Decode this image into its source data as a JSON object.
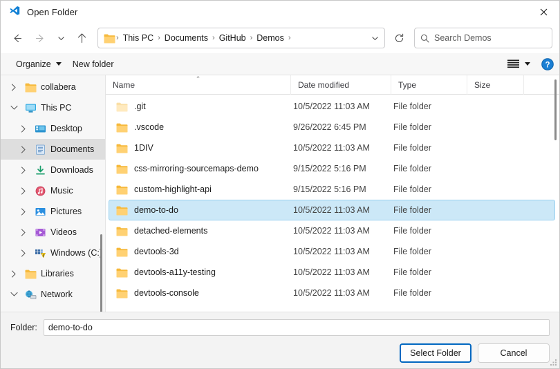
{
  "window": {
    "title": "Open Folder",
    "app_icon": "vscode-icon",
    "close_label": "✕"
  },
  "nav": {
    "back_label": "Back",
    "forward_label": "Forward",
    "recent_label": "Recent locations",
    "up_label": "Up",
    "refresh_label": "Refresh",
    "breadcrumb_dropdown_label": "Previous locations"
  },
  "breadcrumb": {
    "items": [
      "This PC",
      "Documents",
      "GitHub",
      "Demos"
    ],
    "separator": "›"
  },
  "search": {
    "placeholder": "Search Demos",
    "value": "",
    "icon": "search-icon"
  },
  "toolbar": {
    "organize_label": "Organize",
    "new_folder_label": "New folder",
    "view_icon": "list-view-icon",
    "help_icon": "help-icon"
  },
  "sidebar": {
    "items": [
      {
        "label": "collabera",
        "icon": "folder-icon",
        "indent": 1,
        "expanded": false,
        "selected": false
      },
      {
        "label": "This PC",
        "icon": "pc-icon",
        "indent": 1,
        "expanded": true,
        "selected": false
      },
      {
        "label": "Desktop",
        "icon": "desktop-icon",
        "indent": 2,
        "expanded": false,
        "selected": false
      },
      {
        "label": "Documents",
        "icon": "documents-icon",
        "indent": 2,
        "expanded": false,
        "selected": true
      },
      {
        "label": "Downloads",
        "icon": "downloads-icon",
        "indent": 2,
        "expanded": false,
        "selected": false
      },
      {
        "label": "Music",
        "icon": "music-icon",
        "indent": 2,
        "expanded": false,
        "selected": false
      },
      {
        "label": "Pictures",
        "icon": "pictures-icon",
        "indent": 2,
        "expanded": false,
        "selected": false
      },
      {
        "label": "Videos",
        "icon": "videos-icon",
        "indent": 2,
        "expanded": false,
        "selected": false
      },
      {
        "label": "Windows (C:)",
        "icon": "drive-icon",
        "indent": 2,
        "expanded": false,
        "selected": false
      },
      {
        "label": "Libraries",
        "icon": "folder-icon",
        "indent": 1,
        "expanded": false,
        "selected": false
      },
      {
        "label": "Network",
        "icon": "network-icon",
        "indent": 1,
        "expanded": true,
        "selected": false
      }
    ]
  },
  "filelist": {
    "columns": [
      {
        "label": "Name",
        "sorted": "asc"
      },
      {
        "label": "Date modified",
        "sorted": ""
      },
      {
        "label": "Type",
        "sorted": ""
      },
      {
        "label": "Size",
        "sorted": ""
      }
    ],
    "sort_caret": "⌃",
    "rows": [
      {
        "name": ".git",
        "date": "10/5/2022 11:03 AM",
        "type": "File folder",
        "size": "",
        "selected": false,
        "dim": true
      },
      {
        "name": ".vscode",
        "date": "9/26/2022 6:45 PM",
        "type": "File folder",
        "size": "",
        "selected": false,
        "dim": false
      },
      {
        "name": "1DIV",
        "date": "10/5/2022 11:03 AM",
        "type": "File folder",
        "size": "",
        "selected": false,
        "dim": false
      },
      {
        "name": "css-mirroring-sourcemaps-demo",
        "date": "9/15/2022 5:16 PM",
        "type": "File folder",
        "size": "",
        "selected": false,
        "dim": false
      },
      {
        "name": "custom-highlight-api",
        "date": "9/15/2022 5:16 PM",
        "type": "File folder",
        "size": "",
        "selected": false,
        "dim": false
      },
      {
        "name": "demo-to-do",
        "date": "10/5/2022 11:03 AM",
        "type": "File folder",
        "size": "",
        "selected": true,
        "dim": false
      },
      {
        "name": "detached-elements",
        "date": "10/5/2022 11:03 AM",
        "type": "File folder",
        "size": "",
        "selected": false,
        "dim": false
      },
      {
        "name": "devtools-3d",
        "date": "10/5/2022 11:03 AM",
        "type": "File folder",
        "size": "",
        "selected": false,
        "dim": false
      },
      {
        "name": "devtools-a11y-testing",
        "date": "10/5/2022 11:03 AM",
        "type": "File folder",
        "size": "",
        "selected": false,
        "dim": false
      },
      {
        "name": "devtools-console",
        "date": "10/5/2022 11:03 AM",
        "type": "File folder",
        "size": "",
        "selected": false,
        "dim": false
      }
    ]
  },
  "footer": {
    "folder_label": "Folder:",
    "folder_value": "demo-to-do",
    "select_label": "Select Folder",
    "cancel_label": "Cancel"
  },
  "colors": {
    "selection_bg": "#cce8f7",
    "selection_border": "#99d1f0",
    "accent": "#0067c0",
    "folder_yellow": "#ffd173",
    "window_bg": "#f3f3f3"
  }
}
